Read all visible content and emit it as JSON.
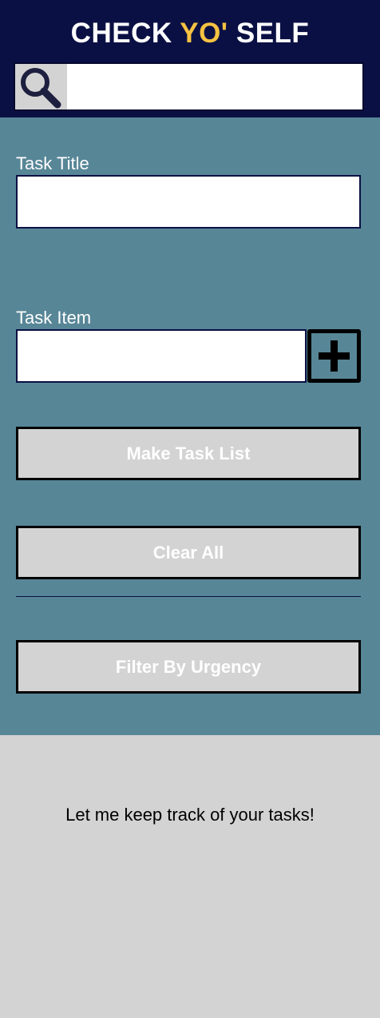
{
  "header": {
    "title_part1": "CHECK ",
    "title_accent": "YO'",
    "title_part2": " SELF",
    "accent_color": "#f5c242",
    "background_color": "#0b1044"
  },
  "search": {
    "icon": "search-icon",
    "value": "",
    "placeholder": ""
  },
  "form": {
    "task_title_label": "Task Title",
    "task_title_value": "",
    "task_item_label": "Task Item",
    "task_item_value": "",
    "add_icon": "plus-icon",
    "make_task_list_label": "Make Task List",
    "clear_all_label": "Clear All",
    "filter_label": "Filter By Urgency",
    "background_color": "#578697"
  },
  "main": {
    "message": "Let me keep track of your tasks!"
  }
}
